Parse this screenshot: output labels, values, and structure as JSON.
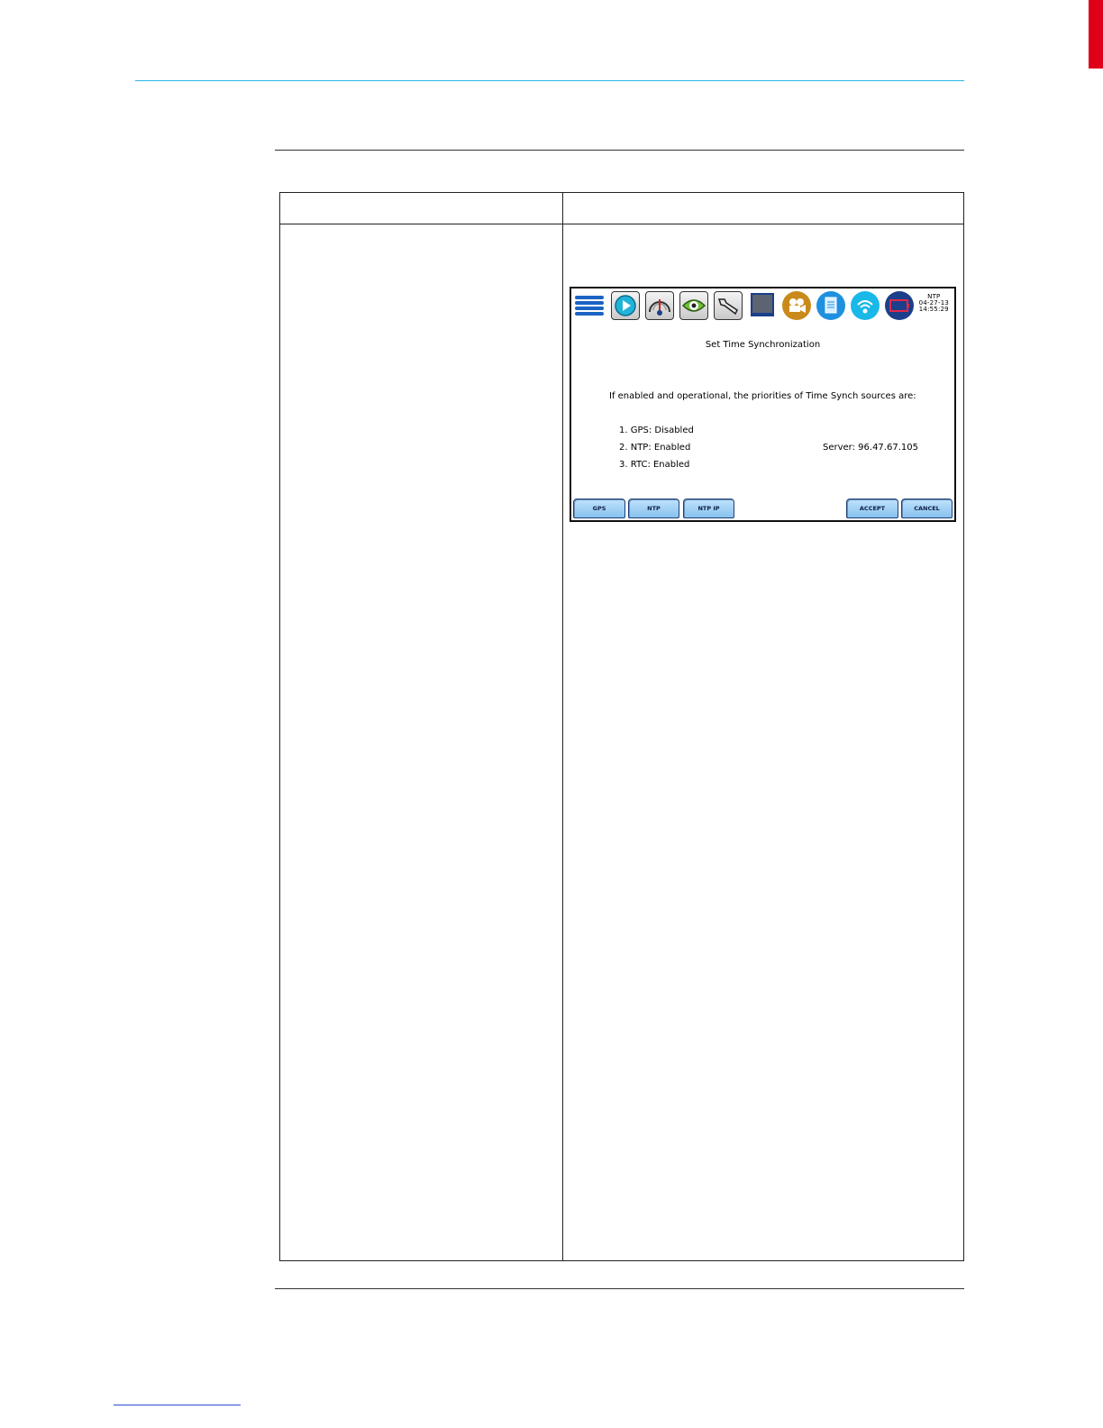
{
  "screen": {
    "status": {
      "source": "NTP",
      "date": "04-27-13",
      "time": "14:55:29"
    },
    "toolbar_icons": [
      "menu-icon",
      "play-icon",
      "meter-gauge-icon",
      "eye-icon",
      "wrench-icon",
      "monitor-icon",
      "camera-icon",
      "document-icon",
      "wireless-icon",
      "battery-icon"
    ],
    "title": "Set Time Synchronization",
    "priority_note": "If enabled and operational, the priorities of Time Synch sources are:",
    "sources": [
      "1. GPS: Disabled",
      "2. NTP: Enabled",
      "3. RTC: Enabled"
    ],
    "server": "Server: 96.47.67.105",
    "buttons": {
      "gps": "GPS",
      "ntp": "NTP",
      "ntp_ip": "NTP IP",
      "accept": "ACCEPT",
      "cancel": "CANCEL"
    }
  },
  "colors": {
    "edge_tab": "#e0001a",
    "header_rule": "#29b6e6",
    "button_fill": "#88c2ef",
    "button_border": "#1f3f73"
  }
}
